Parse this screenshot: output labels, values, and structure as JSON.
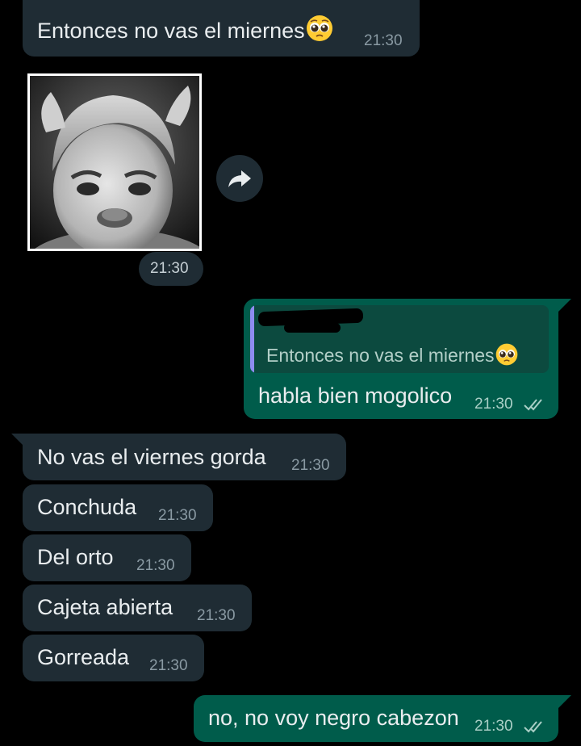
{
  "messages": [
    {
      "type": "in",
      "text": "Entonces no vas el miernes",
      "emoji": "pleading-face-emoji",
      "time": "21:30"
    },
    {
      "type": "in-image",
      "time": "21:30",
      "image_alt": "black and white photo of a pouting toddler"
    },
    {
      "type": "out",
      "quote_text": "Entonces no vas el miernes",
      "quote_emoji": "pleading-face-emoji",
      "text": "habla bien mogolico",
      "time": "21:30",
      "status": "read"
    },
    {
      "type": "in",
      "text": "No vas el viernes gorda",
      "time": "21:30"
    },
    {
      "type": "in",
      "text": "Conchuda",
      "time": "21:30"
    },
    {
      "type": "in",
      "text": "Del orto",
      "time": "21:30"
    },
    {
      "type": "in",
      "text": "Cajeta abierta",
      "time": "21:30"
    },
    {
      "type": "in",
      "text": "Gorreada",
      "time": "21:30"
    },
    {
      "type": "out",
      "text": "no, no voy negro cabezon",
      "time": "21:30",
      "status": "read"
    }
  ],
  "colors": {
    "background": "#000000",
    "incoming_bubble": "#1f2c34",
    "outgoing_bubble": "#005c4b",
    "quote_bar": "#8e8cf0",
    "read_ticks": "#a9cfc6"
  },
  "icons": {
    "forward": "forward-arrow-icon",
    "read_receipt": "double-check-icon"
  }
}
